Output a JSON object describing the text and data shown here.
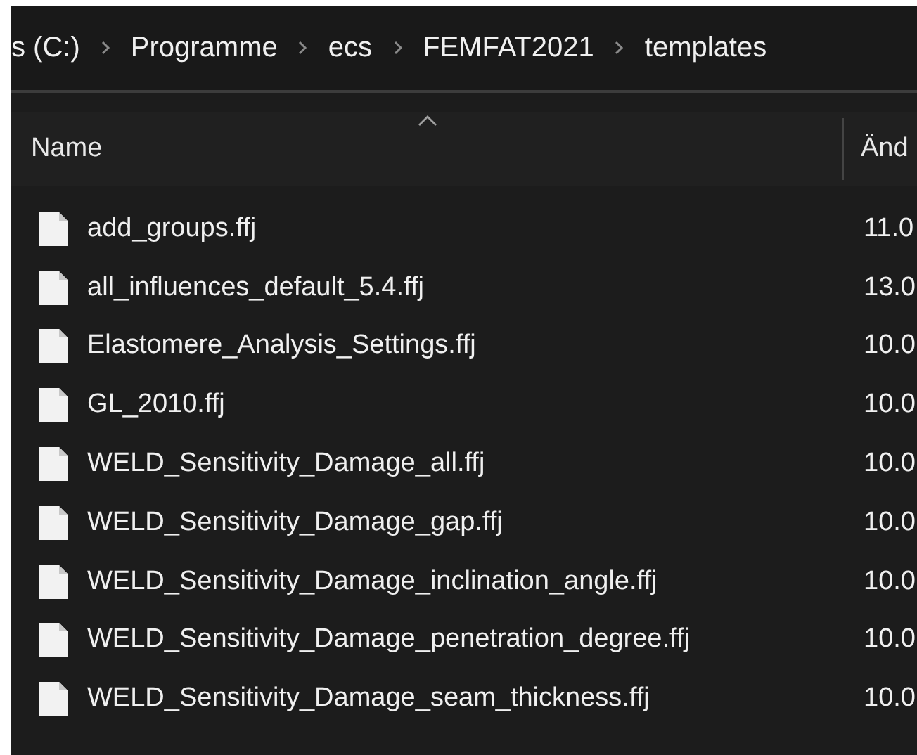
{
  "breadcrumb": [
    "s (C:)",
    "Programme",
    "ecs",
    "FEMFAT2021",
    "templates"
  ],
  "columns": [
    {
      "label": "Name",
      "sorted": true
    },
    {
      "label": "Änd",
      "sorted": false
    }
  ],
  "rows": [
    {
      "name": "add_groups.ffj",
      "date": "11.0"
    },
    {
      "name": "all_influences_default_5.4.ffj",
      "date": "13.0"
    },
    {
      "name": "Elastomere_Analysis_Settings.ffj",
      "date": "10.0"
    },
    {
      "name": "GL_2010.ffj",
      "date": "10.0"
    },
    {
      "name": "WELD_Sensitivity_Damage_all.ffj",
      "date": "10.0"
    },
    {
      "name": "WELD_Sensitivity_Damage_gap.ffj",
      "date": "10.0"
    },
    {
      "name": "WELD_Sensitivity_Damage_inclination_angle.ffj",
      "date": "10.0"
    },
    {
      "name": "WELD_Sensitivity_Damage_penetration_degree.ffj",
      "date": "10.0"
    },
    {
      "name": "WELD_Sensitivity_Damage_seam_thickness.ffj",
      "date": "10.0"
    }
  ]
}
